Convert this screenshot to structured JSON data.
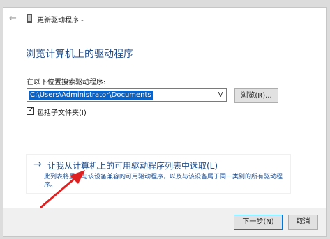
{
  "window": {
    "title": "更新驱动程序 -"
  },
  "page": {
    "heading": "浏览计算机上的驱动程序"
  },
  "search": {
    "label": "在以下位置搜索驱动程序:",
    "path_value": "C:\\Users\\Administrator\\Documents",
    "dropdown_glyph": "V",
    "browse_label": "浏览(R)..."
  },
  "subfolders": {
    "label": "包括子文件夹(I)",
    "checked": true
  },
  "option": {
    "arrow": "→",
    "title": "让我从计算机上的可用驱动程序列表中选取(L)",
    "description": "此列表将显示与该设备兼容的可用驱动程序，以及与该设备属于同一类别的所有驱动程序。"
  },
  "footer": {
    "next_label": "下一步(N)",
    "cancel_label": "取消"
  },
  "colors": {
    "accent": "#1f4e8c",
    "selection": "#0a64c8",
    "annotation_arrow": "#e02020"
  },
  "icons": {
    "back": "back-arrow-icon",
    "device": "device-icon",
    "check": "checkmark-icon"
  }
}
